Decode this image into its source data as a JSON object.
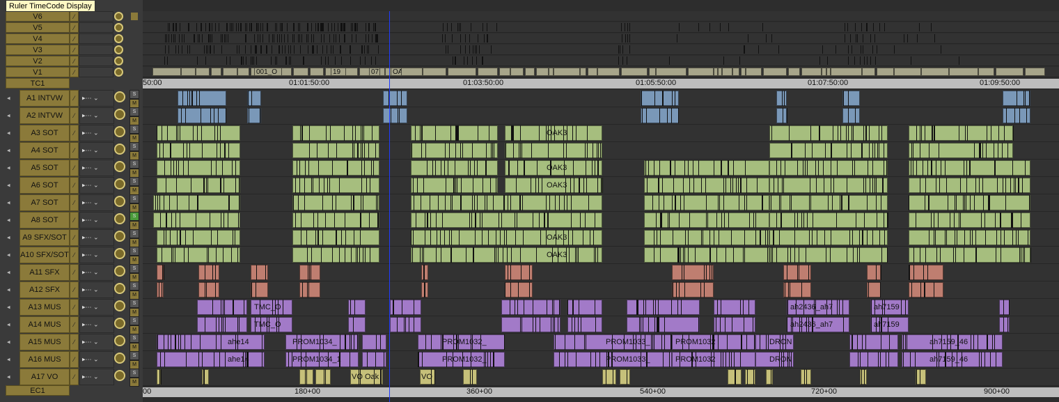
{
  "tooltip": "Ruler TimeCode Display",
  "tracks_video": [
    {
      "name": "V6",
      "lock": "⁄"
    },
    {
      "name": "V5",
      "lock": "⁄"
    },
    {
      "name": "V4",
      "lock": "⁄"
    },
    {
      "name": "V3",
      "lock": "⁄"
    },
    {
      "name": "V2",
      "lock": "⁄"
    },
    {
      "name": "V1",
      "lock": "⁄"
    }
  ],
  "tc_track": "TC1",
  "ec_track": "EC1",
  "tracks_audio": [
    {
      "name": "A1 INTVW"
    },
    {
      "name": "A2 INTVW"
    },
    {
      "name": "A3 SOT"
    },
    {
      "name": "A4 SOT"
    },
    {
      "name": "A5 SOT"
    },
    {
      "name": "A6 SOT"
    },
    {
      "name": "A7 SOT"
    },
    {
      "name": "A8 SOT"
    },
    {
      "name": "A9 SFX/SOT"
    },
    {
      "name": "A10 SFX/SOT"
    },
    {
      "name": "A11 SFX"
    },
    {
      "name": "A12 SFX"
    },
    {
      "name": "A13 MUS"
    },
    {
      "name": "A14 MUS"
    },
    {
      "name": "A15 MUS"
    },
    {
      "name": "A16 MUS"
    },
    {
      "name": "A17 VO"
    }
  ],
  "solo_label": "S",
  "mute_label": "M",
  "tc_ruler": [
    "50:00",
    "01:01:50:00",
    "01:03:50:00",
    "01:05:50:00",
    "01:07:50:00",
    "01:09:50:00"
  ],
  "ec_ruler": [
    "00",
    "180+00",
    "360+00",
    "540+00",
    "720+00",
    "900+00"
  ],
  "clip_labels": {
    "v1_a": "001_O",
    "v1_b": "19",
    "v1_c": "07",
    "v1_d": "OA",
    "a3_oak": "OAK3",
    "a5_oak": "OAK3",
    "a6_oak": "OAK3",
    "a9_oak": "OAK3",
    "a10_oak": "OAK3",
    "a13_tmc": "TMC_O",
    "a14_tmc": "TMC_O",
    "a13_ah": "ah7159",
    "a14_ah": "ah7159",
    "a13_ah2": "ah2436_ah7",
    "a14_ah2": "ah2436_ah7",
    "a15_p1": "PROM1034_",
    "a16_p1": "PROM1034_1",
    "a15_p2": "PROM1032_",
    "a16_p2": "PROM1032_",
    "a15_p3": "PROM1033_",
    "a16_p3": "PROM1033_",
    "a15_p4": "PROM1032",
    "a16_p4": "PROM1032",
    "a15_d": "DRON",
    "a16_d": "DRON",
    "a15_ah": "ah7159_46",
    "a16_ah": "ah7159_46",
    "a15_ahe": "ahe14",
    "a16_ahe": "ahe14",
    "a17_vo": "VO Oak",
    "a17_vo2": "VO"
  }
}
